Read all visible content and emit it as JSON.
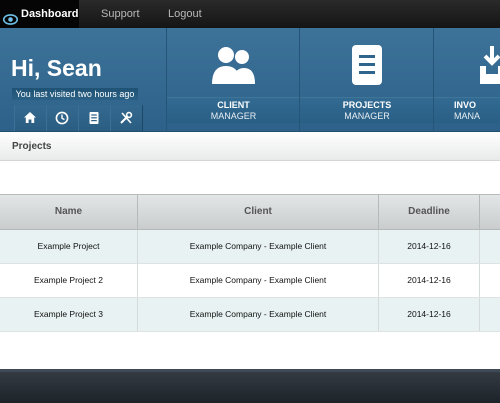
{
  "nav": {
    "dashboard": "Dashboard",
    "support": "Support",
    "logout": "Logout"
  },
  "greeting": {
    "hi": "Hi, Sean",
    "last_visited": "You last visited two hours ago"
  },
  "quick_icons": [
    "home-icon",
    "clock-icon",
    "document-icon",
    "tools-icon"
  ],
  "tiles": [
    {
      "line1": "CLIENT",
      "line2": "MANAGER",
      "icon": "users-icon"
    },
    {
      "line1": "PROJECTS",
      "line2": "MANAGER",
      "icon": "document-icon"
    },
    {
      "line1": "INVO",
      "line2": "MANA",
      "icon": "inbox-download-icon"
    }
  ],
  "projects": {
    "title": "Projects",
    "columns": [
      "Name",
      "Client",
      "Deadline",
      ""
    ],
    "rows": [
      {
        "name": "Example Project",
        "client": "Example Company - Example Client",
        "deadline": "2014-12-16"
      },
      {
        "name": "Example Project 2",
        "client": "Example Company - Example Client",
        "deadline": "2014-12-16"
      },
      {
        "name": "Example Project 3",
        "client": "Example Company - Example Client",
        "deadline": "2014-12-16"
      }
    ]
  },
  "colors": {
    "banner": "#336791",
    "nav_bg": "#1b1b1b",
    "row_alt": "#e8f2f2"
  }
}
